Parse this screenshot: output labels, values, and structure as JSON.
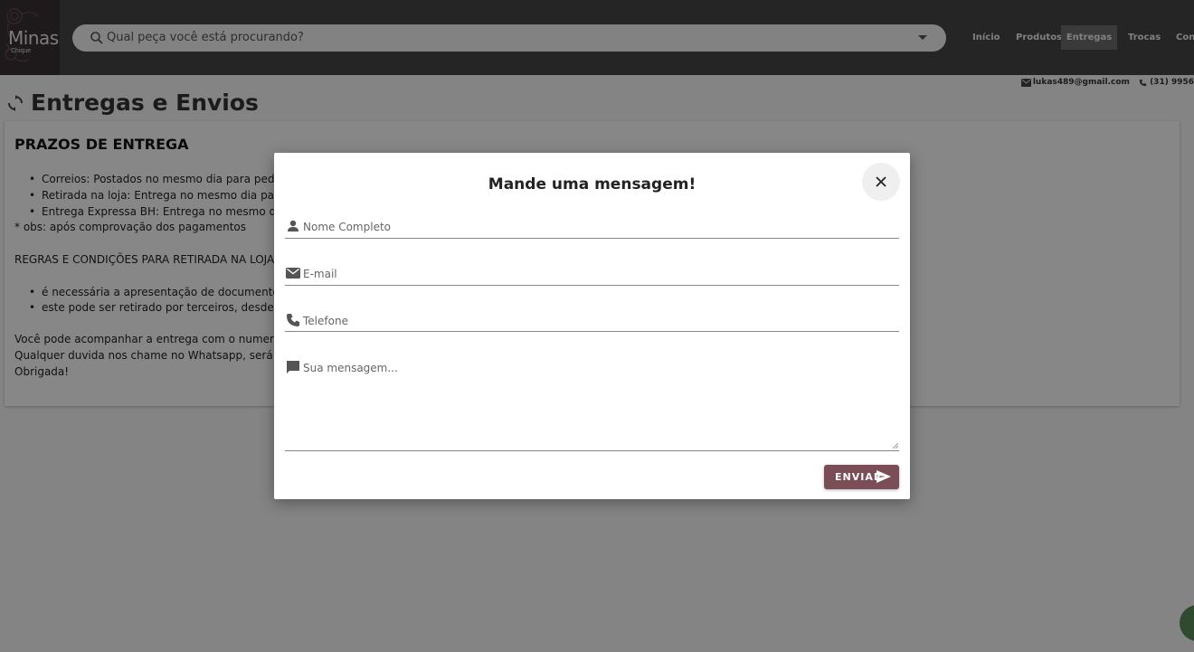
{
  "header": {
    "brand": "Minas",
    "brand_sub": "Chique",
    "search_placeholder": "Qual peça você está procurando?",
    "nav": [
      "Início",
      "Produtos",
      "Entregas",
      "Trocas",
      "Cont"
    ],
    "active_nav": "Entregas",
    "email": "lukas489@gmail.com",
    "phone": "(31) 9956"
  },
  "page": {
    "title": "Entregas e Envios",
    "section_title": "PRAZOS DE ENTREGA",
    "bullets1": [
      "Correios: Postados no mesmo dia para pedidos c",
      "Retirada na loja: Entrega no mesmo dia para pedi",
      "Entrega Expressa BH: Entrega no mesmo dia para"
    ],
    "obs": "* obs: após comprovação dos pagamentos",
    "rules_title": "REGRAS E CONDIÇÕES PARA RETIRADA NA LOJA",
    "bullets2": [
      "é necessária a apresentação de documento com",
      "este pode ser retirado por terceiros, desde que ap"
    ],
    "footer_lines": [
      "Você pode acompanhar a entrega com o numero do se",
      "Qualquer duvida nos chame no Whatsapp, será um pra",
      "Obrigada!"
    ]
  },
  "modal": {
    "title": "Mande uma mensagem!",
    "fields": {
      "name": "Nome Completo",
      "email": "E-mail",
      "phone": "Telefone",
      "message": "Sua mensagem..."
    },
    "send_label": "ENVIAR"
  },
  "colors": {
    "header_bg": "#474747",
    "send_button": "#7a4d57",
    "overlay": "rgba(0,0,0,0.47)"
  }
}
